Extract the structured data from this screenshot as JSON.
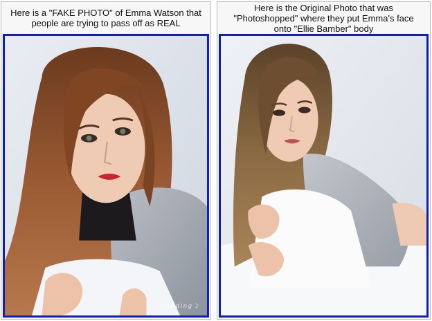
{
  "left_panel": {
    "caption_line1": "Here is a \"FAKE PHOTO\" of Emma Watson that",
    "caption_line2": "people are trying to pass off as REAL",
    "watermark": "Trending☽"
  },
  "right_panel": {
    "caption_line1": "Here is the Original Photo that was",
    "caption_line2": "\"Photoshopped\" where they put Emma's face",
    "caption_line3": "onto \"Ellie Bamber\" body"
  },
  "colors": {
    "frame_blue": "#0f1fb8",
    "panel_bg": "#f7f7f7"
  }
}
